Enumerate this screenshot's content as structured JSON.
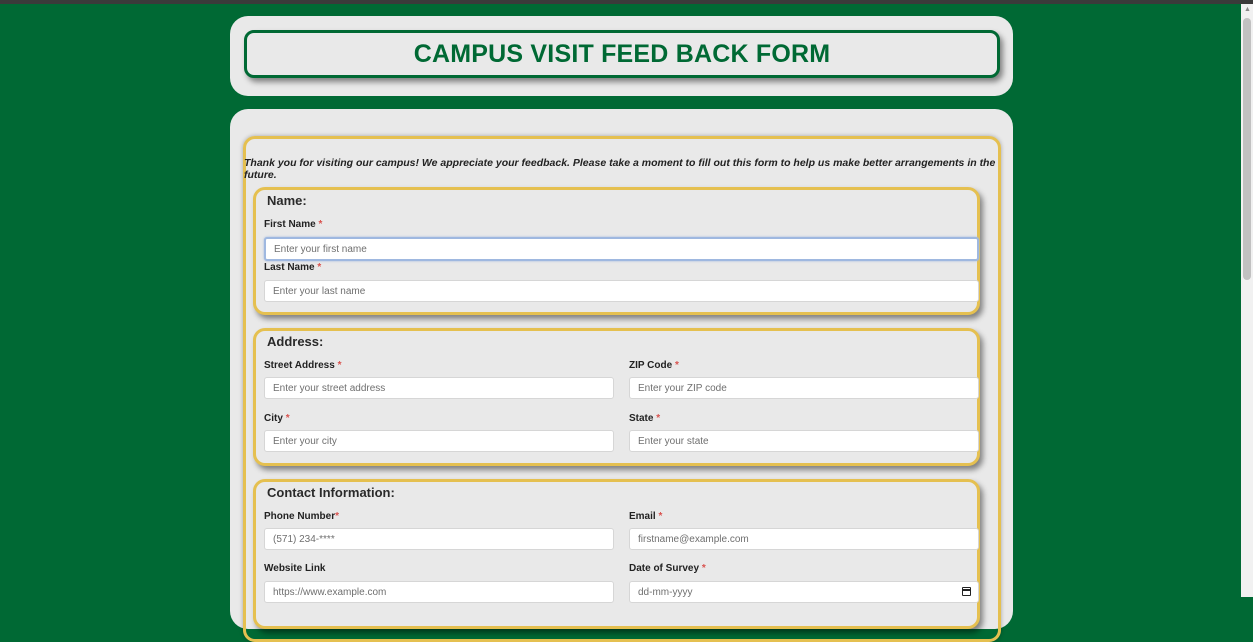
{
  "header": {
    "title": "CAMPUS VISIT FEED BACK FORM"
  },
  "intro": "Thank you for visiting our campus! We appreciate your feedback. Please take a moment to fill out this form to help us make better arrangements in the future.",
  "required_marker": "*",
  "name_section": {
    "title": "Name:",
    "first_name": {
      "label": "First Name",
      "placeholder": "Enter your first name"
    },
    "last_name": {
      "label": "Last Name",
      "placeholder": "Enter your last name"
    }
  },
  "address_section": {
    "title": "Address:",
    "street": {
      "label": "Street Address",
      "placeholder": "Enter your street address"
    },
    "zip": {
      "label": "ZIP Code",
      "placeholder": "Enter your ZIP code"
    },
    "city": {
      "label": "City",
      "placeholder": "Enter your city"
    },
    "state": {
      "label": "State",
      "placeholder": "Enter your state"
    }
  },
  "contact_section": {
    "title": "Contact Information:",
    "phone": {
      "label": "Phone Number",
      "placeholder": "(571) 234-****"
    },
    "email": {
      "label": "Email",
      "placeholder": "firstname@example.com"
    },
    "website": {
      "label": "Website Link",
      "placeholder": "https://www.example.com"
    },
    "date": {
      "label": "Date of Survey",
      "placeholder": "dd-mm-yyyy"
    }
  },
  "colors": {
    "brand_green": "#006934",
    "gold_border": "#e5c050",
    "card_bg": "#e9e9e9",
    "required": "#d9534f"
  }
}
